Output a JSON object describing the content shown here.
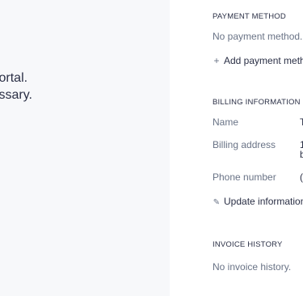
{
  "left_panel": {
    "lines": [
      "portal.",
      "essary."
    ]
  },
  "payment_method": {
    "heading": "PAYMENT METHOD",
    "empty_text": "No payment method.",
    "add_icon": "+",
    "add_label": "Add payment method"
  },
  "billing": {
    "heading": "BILLING INFORMATION",
    "name_label": "Name",
    "name_value": "T",
    "address_label": "Billing address",
    "address_value_line1": "1",
    "address_value_line2": "b",
    "phone_label": "Phone number",
    "phone_value": "(",
    "update_icon": "✎",
    "update_label": "Update information"
  },
  "invoices": {
    "heading": "INVOICE HISTORY",
    "empty_text": "No invoice history."
  }
}
